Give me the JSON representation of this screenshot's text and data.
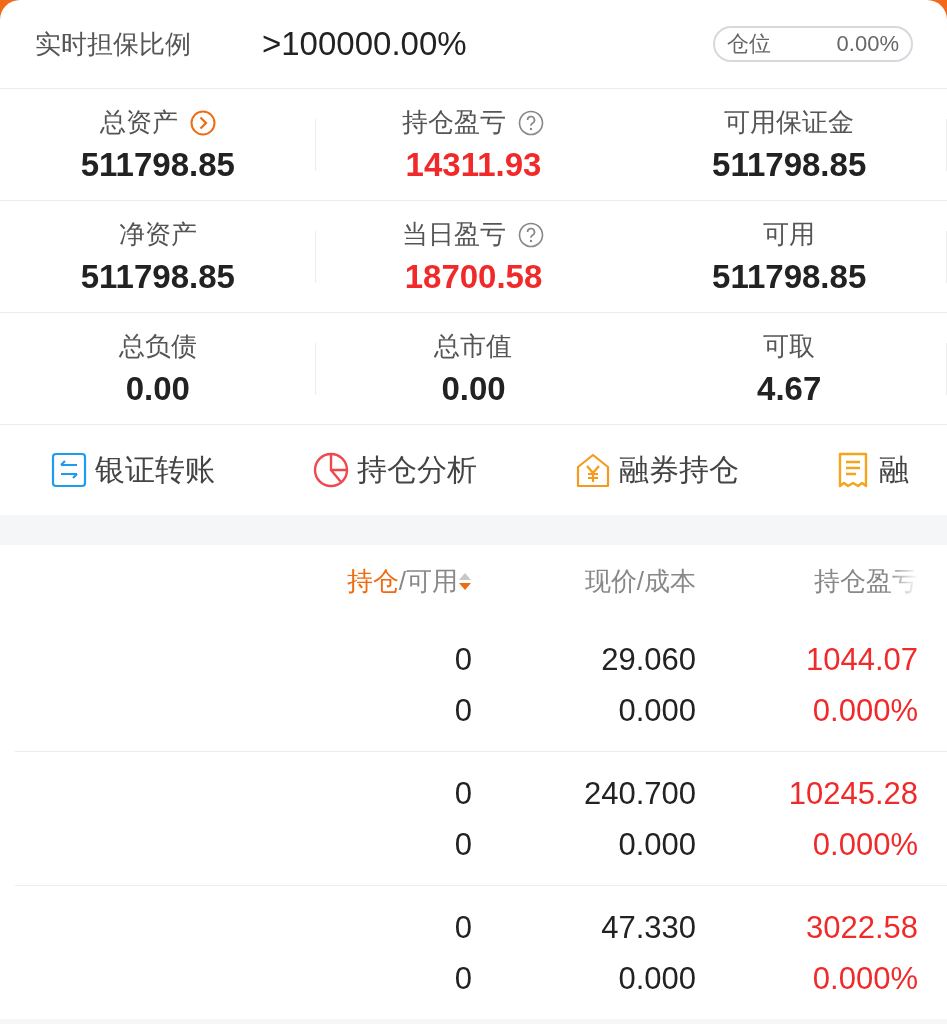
{
  "summary": {
    "label": "实时担保比例",
    "value": ">100000.00%",
    "position": {
      "label": "仓位",
      "value": "0.00%"
    }
  },
  "stats": [
    {
      "label": "总资产",
      "kind": "link",
      "value": "511798.85",
      "highlight": false
    },
    {
      "label": "持仓盈亏",
      "kind": "help",
      "value": "14311.93",
      "highlight": true
    },
    {
      "label": "可用保证金",
      "kind": "plain",
      "value": "511798.85",
      "highlight": false
    },
    {
      "label": "净资产",
      "kind": "plain",
      "value": "511798.85",
      "highlight": false
    },
    {
      "label": "当日盈亏",
      "kind": "help",
      "value": "18700.58",
      "highlight": true
    },
    {
      "label": "可用",
      "kind": "plain",
      "value": "511798.85",
      "highlight": false
    },
    {
      "label": "总负债",
      "kind": "plain",
      "value": "0.00",
      "highlight": false
    },
    {
      "label": "总市值",
      "kind": "plain",
      "value": "0.00",
      "highlight": false
    },
    {
      "label": "可取",
      "kind": "plain",
      "value": "4.67",
      "highlight": false
    }
  ],
  "actions": [
    {
      "kind": "transfer",
      "label": "银证转账"
    },
    {
      "kind": "pie",
      "label": "持仓分析"
    },
    {
      "kind": "yen-house",
      "label": "融券持仓"
    },
    {
      "kind": "receipt",
      "label": "融"
    }
  ],
  "holdings": {
    "columns": [
      {
        "label": "持仓",
        "sub": "/可用",
        "sorted": true
      },
      {
        "label": "现价",
        "sub": "/成本",
        "sorted": false
      },
      {
        "label": "持仓盈亏",
        "sorted": false,
        "faded": true
      }
    ],
    "rows": [
      {
        "qty": "0",
        "available": "0",
        "price": "29.060",
        "cost": "0.000",
        "pl": "1044.07",
        "pl_pct": "0.000%",
        "gain": true
      },
      {
        "qty": "0",
        "available": "0",
        "price": "240.700",
        "cost": "0.000",
        "pl": "10245.28",
        "pl_pct": "0.000%",
        "gain": true
      },
      {
        "qty": "0",
        "available": "0",
        "price": "47.330",
        "cost": "0.000",
        "pl": "3022.58",
        "pl_pct": "0.000%",
        "gain": true
      }
    ]
  }
}
